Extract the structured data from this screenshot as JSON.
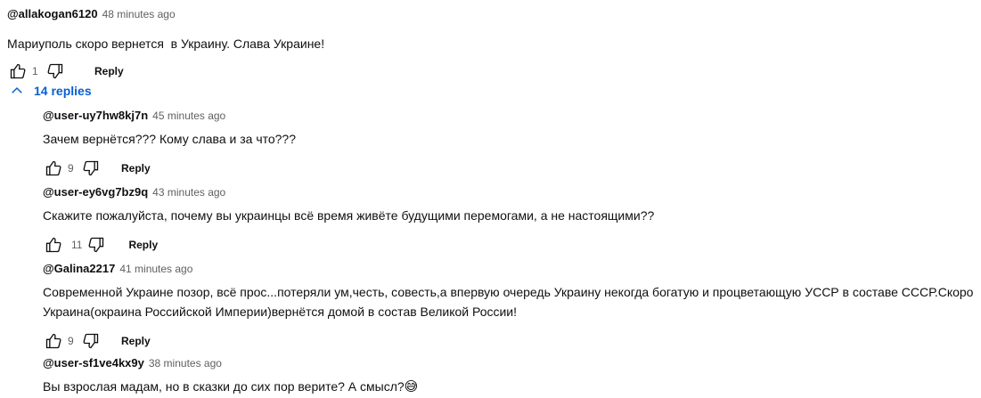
{
  "top_comment": {
    "author": "@allakogan6120",
    "time": "48 minutes ago",
    "text": "Мариуполь скоро вернется  в Украину. Слава Украине!",
    "likes": "1",
    "reply_label": "Reply"
  },
  "replies_toggle": {
    "label": "14 replies"
  },
  "replies": [
    {
      "author": "@user-uy7hw8kj7n",
      "time": "45 minutes ago",
      "text": "Зачем вернётся??? Кому слава и за что???",
      "likes": "9",
      "reply_label": "Reply"
    },
    {
      "author": "@user-ey6vg7bz9q",
      "time": "43 minutes ago",
      "text": "Скажите пожалуйста, почему вы украинцы всё время живёте будущими перемогами, а не настоящими??",
      "likes": "11",
      "reply_label": "Reply"
    },
    {
      "author": "@Galina2217",
      "time": "41 minutes ago",
      "text": "Современной Украине позор, всё прос...потеряли ум,честь, совесть,а впервую очередь Украину некогда богатую и процветающую УССР в составе СССР.Скоро\nУкраина(окраина Российской Империи)вернётся домой в состав Великой России!",
      "likes": "9",
      "reply_label": "Reply"
    },
    {
      "author": "@user-sf1ve4kx9y",
      "time": "38 minutes ago",
      "text": "Вы взрослая мадам, но в сказки до сих пор верите? А смысл?",
      "emoji": "😅"
    }
  ],
  "colors": {
    "link": "#065fd4",
    "meta": "#606060",
    "text": "#0f0f0f"
  },
  "icons": [
    "thumb-up-icon",
    "thumb-down-icon",
    "chevron-up-icon"
  ]
}
